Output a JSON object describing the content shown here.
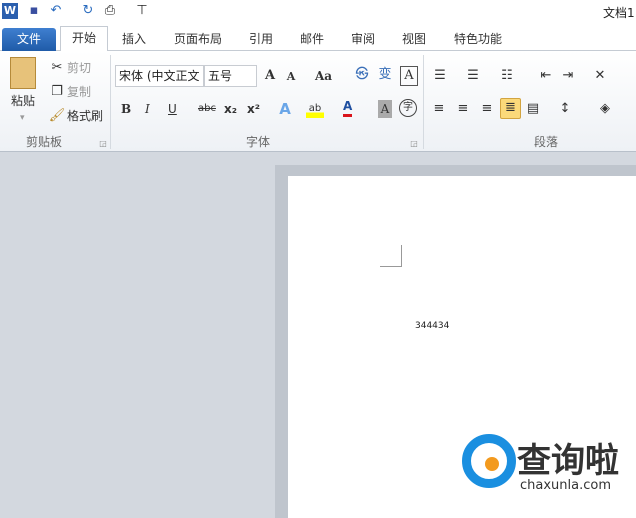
{
  "title": "文档1",
  "quick_access": {
    "app_icon": "word-icon",
    "save": "save-icon",
    "undo": "undo-icon",
    "redo": "redo-icon",
    "customize": "customize-icon"
  },
  "tabs": [
    "文件",
    "开始",
    "插入",
    "页面布局",
    "引用",
    "邮件",
    "审阅",
    "视图",
    "特色功能"
  ],
  "clipboard": {
    "paste": "粘贴",
    "cut": "剪切",
    "copy": "复制",
    "format_painter": "格式刷",
    "label": "剪贴板"
  },
  "font": {
    "name": "宋体 (中文正文",
    "size": "五号",
    "label": "字体",
    "case": "Aa",
    "bold": "B",
    "italic": "I",
    "underline": "U",
    "strike": "abc",
    "sub": "x₂",
    "sup": "x²",
    "color": "A",
    "char_shading": "A",
    "enclose": "字"
  },
  "paragraph": {
    "label": "段落"
  },
  "document": {
    "text": "344434"
  },
  "watermark": {
    "brand": "查询啦",
    "url": "chaxunla.com"
  },
  "colors": {
    "file_tab": "#2b6cbf",
    "font_color": "#d9141b",
    "highlight": "#ffff00",
    "active_justify": "#fbd97a"
  }
}
